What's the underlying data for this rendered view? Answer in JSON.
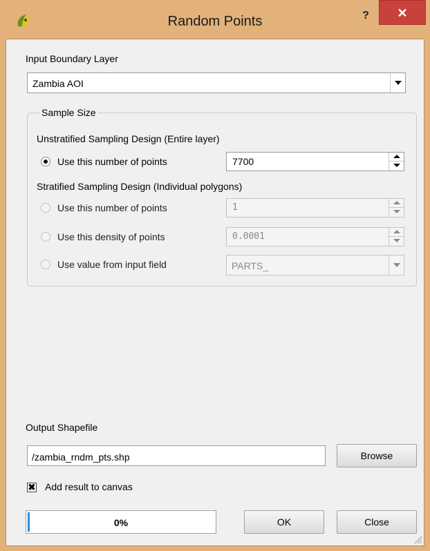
{
  "window": {
    "title": "Random Points",
    "help_label": "?",
    "close_label": "✕",
    "icon": "qgis-icon",
    "accent_color": "#e2b27a",
    "close_color": "#c9413b"
  },
  "input": {
    "label": "Input Boundary Layer",
    "value": "Zambia AOI"
  },
  "sample_size": {
    "title": "Sample Size",
    "unstratified_label": "Unstratified Sampling Design (Entire layer)",
    "unstratified_option": {
      "label": "Use this number of points",
      "value": "7700",
      "checked": true
    },
    "stratified_label": "Stratified Sampling Design (Individual polygons)",
    "stratified_options": [
      {
        "label": "Use this number of points",
        "value": "1"
      },
      {
        "label": "Use this density of points",
        "value": "0.0001"
      },
      {
        "label": "Use value from input field",
        "value": "PARTS_"
      }
    ]
  },
  "output": {
    "label": "Output Shapefile",
    "value": "/zambia_rndm_pts.shp",
    "browse_label": "Browse"
  },
  "add_to_canvas": {
    "label": "Add result to canvas",
    "checked": true,
    "mark": "✖"
  },
  "progress": {
    "text": "0%",
    "value": 0
  },
  "buttons": {
    "ok": "OK",
    "close": "Close"
  }
}
